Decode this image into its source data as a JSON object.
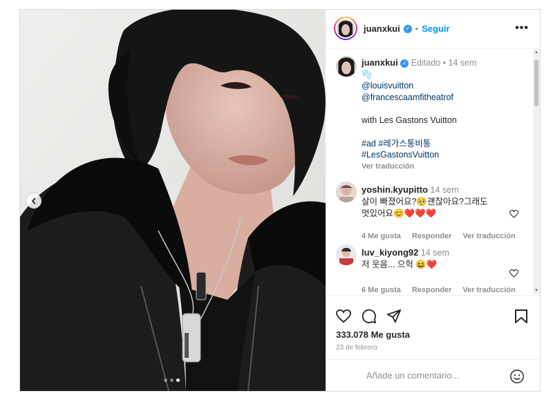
{
  "post": {
    "username": "juanxkui",
    "follow_label": "Seguir",
    "more_icon": "•••",
    "verified_icon": "✓"
  },
  "caption": {
    "username": "juanxkui",
    "edited": "Editado",
    "separator": "•",
    "time": "14 sem",
    "line1": "🫧",
    "mention1": "@louisvuitton",
    "mention2": "@francescaamfitheatrof",
    "text": "with Les Gastons Vuitton",
    "hashtags1": "#ad #레가스통비통",
    "hashtags2": "#LesGastonsVuitton",
    "translate": "Ver traducción"
  },
  "comments": [
    {
      "username": "yoshin.kyupitto",
      "time": "14 sem",
      "line1": "살이 빠졌어요?🥺괜찮아요?그래도",
      "line2": "멋있어요😊❤️❤️❤️",
      "likes": "4 Me gusta",
      "reply": "Responder",
      "translate": "Ver traducción"
    },
    {
      "username": "luv_kiyong92",
      "time": "14 sem",
      "line1": "저 웃음... 으헉 😆❤️",
      "likes": "6 Me gusta",
      "reply": "Responder",
      "translate": "Ver traducción"
    }
  ],
  "stats": {
    "likes": "333.078 Me gusta",
    "date": "23 de febrero"
  },
  "comment_box": {
    "placeholder": "Añade un comentario..."
  },
  "carousel": {
    "slides": 3,
    "active_index": 2
  },
  "colors": {
    "accent": "#0095f6",
    "verified": "#3897f0",
    "heart": "#ed4956",
    "muted": "#8e8e8e"
  }
}
